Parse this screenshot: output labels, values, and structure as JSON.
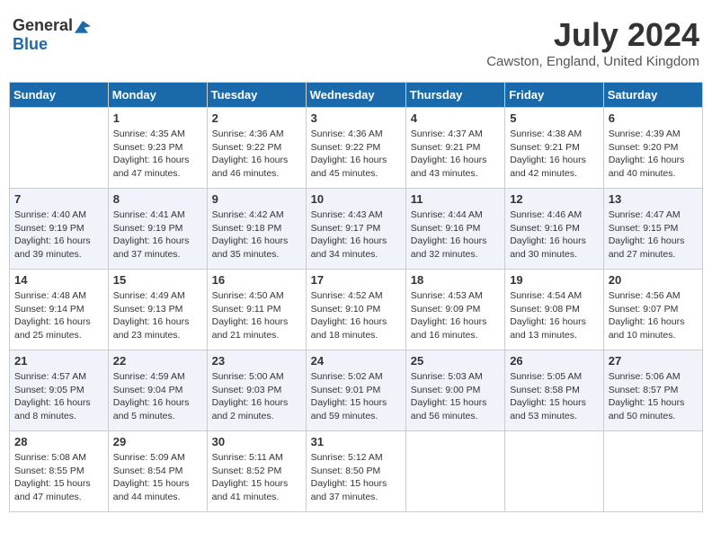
{
  "logo": {
    "general": "General",
    "blue": "Blue"
  },
  "title": "July 2024",
  "location": "Cawston, England, United Kingdom",
  "days_of_week": [
    "Sunday",
    "Monday",
    "Tuesday",
    "Wednesday",
    "Thursday",
    "Friday",
    "Saturday"
  ],
  "weeks": [
    [
      {
        "day": "",
        "sunrise": "",
        "sunset": "",
        "daylight": ""
      },
      {
        "day": "1",
        "sunrise": "Sunrise: 4:35 AM",
        "sunset": "Sunset: 9:23 PM",
        "daylight": "Daylight: 16 hours and 47 minutes."
      },
      {
        "day": "2",
        "sunrise": "Sunrise: 4:36 AM",
        "sunset": "Sunset: 9:22 PM",
        "daylight": "Daylight: 16 hours and 46 minutes."
      },
      {
        "day": "3",
        "sunrise": "Sunrise: 4:36 AM",
        "sunset": "Sunset: 9:22 PM",
        "daylight": "Daylight: 16 hours and 45 minutes."
      },
      {
        "day": "4",
        "sunrise": "Sunrise: 4:37 AM",
        "sunset": "Sunset: 9:21 PM",
        "daylight": "Daylight: 16 hours and 43 minutes."
      },
      {
        "day": "5",
        "sunrise": "Sunrise: 4:38 AM",
        "sunset": "Sunset: 9:21 PM",
        "daylight": "Daylight: 16 hours and 42 minutes."
      },
      {
        "day": "6",
        "sunrise": "Sunrise: 4:39 AM",
        "sunset": "Sunset: 9:20 PM",
        "daylight": "Daylight: 16 hours and 40 minutes."
      }
    ],
    [
      {
        "day": "7",
        "sunrise": "Sunrise: 4:40 AM",
        "sunset": "Sunset: 9:19 PM",
        "daylight": "Daylight: 16 hours and 39 minutes."
      },
      {
        "day": "8",
        "sunrise": "Sunrise: 4:41 AM",
        "sunset": "Sunset: 9:19 PM",
        "daylight": "Daylight: 16 hours and 37 minutes."
      },
      {
        "day": "9",
        "sunrise": "Sunrise: 4:42 AM",
        "sunset": "Sunset: 9:18 PM",
        "daylight": "Daylight: 16 hours and 35 minutes."
      },
      {
        "day": "10",
        "sunrise": "Sunrise: 4:43 AM",
        "sunset": "Sunset: 9:17 PM",
        "daylight": "Daylight: 16 hours and 34 minutes."
      },
      {
        "day": "11",
        "sunrise": "Sunrise: 4:44 AM",
        "sunset": "Sunset: 9:16 PM",
        "daylight": "Daylight: 16 hours and 32 minutes."
      },
      {
        "day": "12",
        "sunrise": "Sunrise: 4:46 AM",
        "sunset": "Sunset: 9:16 PM",
        "daylight": "Daylight: 16 hours and 30 minutes."
      },
      {
        "day": "13",
        "sunrise": "Sunrise: 4:47 AM",
        "sunset": "Sunset: 9:15 PM",
        "daylight": "Daylight: 16 hours and 27 minutes."
      }
    ],
    [
      {
        "day": "14",
        "sunrise": "Sunrise: 4:48 AM",
        "sunset": "Sunset: 9:14 PM",
        "daylight": "Daylight: 16 hours and 25 minutes."
      },
      {
        "day": "15",
        "sunrise": "Sunrise: 4:49 AM",
        "sunset": "Sunset: 9:13 PM",
        "daylight": "Daylight: 16 hours and 23 minutes."
      },
      {
        "day": "16",
        "sunrise": "Sunrise: 4:50 AM",
        "sunset": "Sunset: 9:11 PM",
        "daylight": "Daylight: 16 hours and 21 minutes."
      },
      {
        "day": "17",
        "sunrise": "Sunrise: 4:52 AM",
        "sunset": "Sunset: 9:10 PM",
        "daylight": "Daylight: 16 hours and 18 minutes."
      },
      {
        "day": "18",
        "sunrise": "Sunrise: 4:53 AM",
        "sunset": "Sunset: 9:09 PM",
        "daylight": "Daylight: 16 hours and 16 minutes."
      },
      {
        "day": "19",
        "sunrise": "Sunrise: 4:54 AM",
        "sunset": "Sunset: 9:08 PM",
        "daylight": "Daylight: 16 hours and 13 minutes."
      },
      {
        "day": "20",
        "sunrise": "Sunrise: 4:56 AM",
        "sunset": "Sunset: 9:07 PM",
        "daylight": "Daylight: 16 hours and 10 minutes."
      }
    ],
    [
      {
        "day": "21",
        "sunrise": "Sunrise: 4:57 AM",
        "sunset": "Sunset: 9:05 PM",
        "daylight": "Daylight: 16 hours and 8 minutes."
      },
      {
        "day": "22",
        "sunrise": "Sunrise: 4:59 AM",
        "sunset": "Sunset: 9:04 PM",
        "daylight": "Daylight: 16 hours and 5 minutes."
      },
      {
        "day": "23",
        "sunrise": "Sunrise: 5:00 AM",
        "sunset": "Sunset: 9:03 PM",
        "daylight": "Daylight: 16 hours and 2 minutes."
      },
      {
        "day": "24",
        "sunrise": "Sunrise: 5:02 AM",
        "sunset": "Sunset: 9:01 PM",
        "daylight": "Daylight: 15 hours and 59 minutes."
      },
      {
        "day": "25",
        "sunrise": "Sunrise: 5:03 AM",
        "sunset": "Sunset: 9:00 PM",
        "daylight": "Daylight: 15 hours and 56 minutes."
      },
      {
        "day": "26",
        "sunrise": "Sunrise: 5:05 AM",
        "sunset": "Sunset: 8:58 PM",
        "daylight": "Daylight: 15 hours and 53 minutes."
      },
      {
        "day": "27",
        "sunrise": "Sunrise: 5:06 AM",
        "sunset": "Sunset: 8:57 PM",
        "daylight": "Daylight: 15 hours and 50 minutes."
      }
    ],
    [
      {
        "day": "28",
        "sunrise": "Sunrise: 5:08 AM",
        "sunset": "Sunset: 8:55 PM",
        "daylight": "Daylight: 15 hours and 47 minutes."
      },
      {
        "day": "29",
        "sunrise": "Sunrise: 5:09 AM",
        "sunset": "Sunset: 8:54 PM",
        "daylight": "Daylight: 15 hours and 44 minutes."
      },
      {
        "day": "30",
        "sunrise": "Sunrise: 5:11 AM",
        "sunset": "Sunset: 8:52 PM",
        "daylight": "Daylight: 15 hours and 41 minutes."
      },
      {
        "day": "31",
        "sunrise": "Sunrise: 5:12 AM",
        "sunset": "Sunset: 8:50 PM",
        "daylight": "Daylight: 15 hours and 37 minutes."
      },
      {
        "day": "",
        "sunrise": "",
        "sunset": "",
        "daylight": ""
      },
      {
        "day": "",
        "sunrise": "",
        "sunset": "",
        "daylight": ""
      },
      {
        "day": "",
        "sunrise": "",
        "sunset": "",
        "daylight": ""
      }
    ]
  ]
}
